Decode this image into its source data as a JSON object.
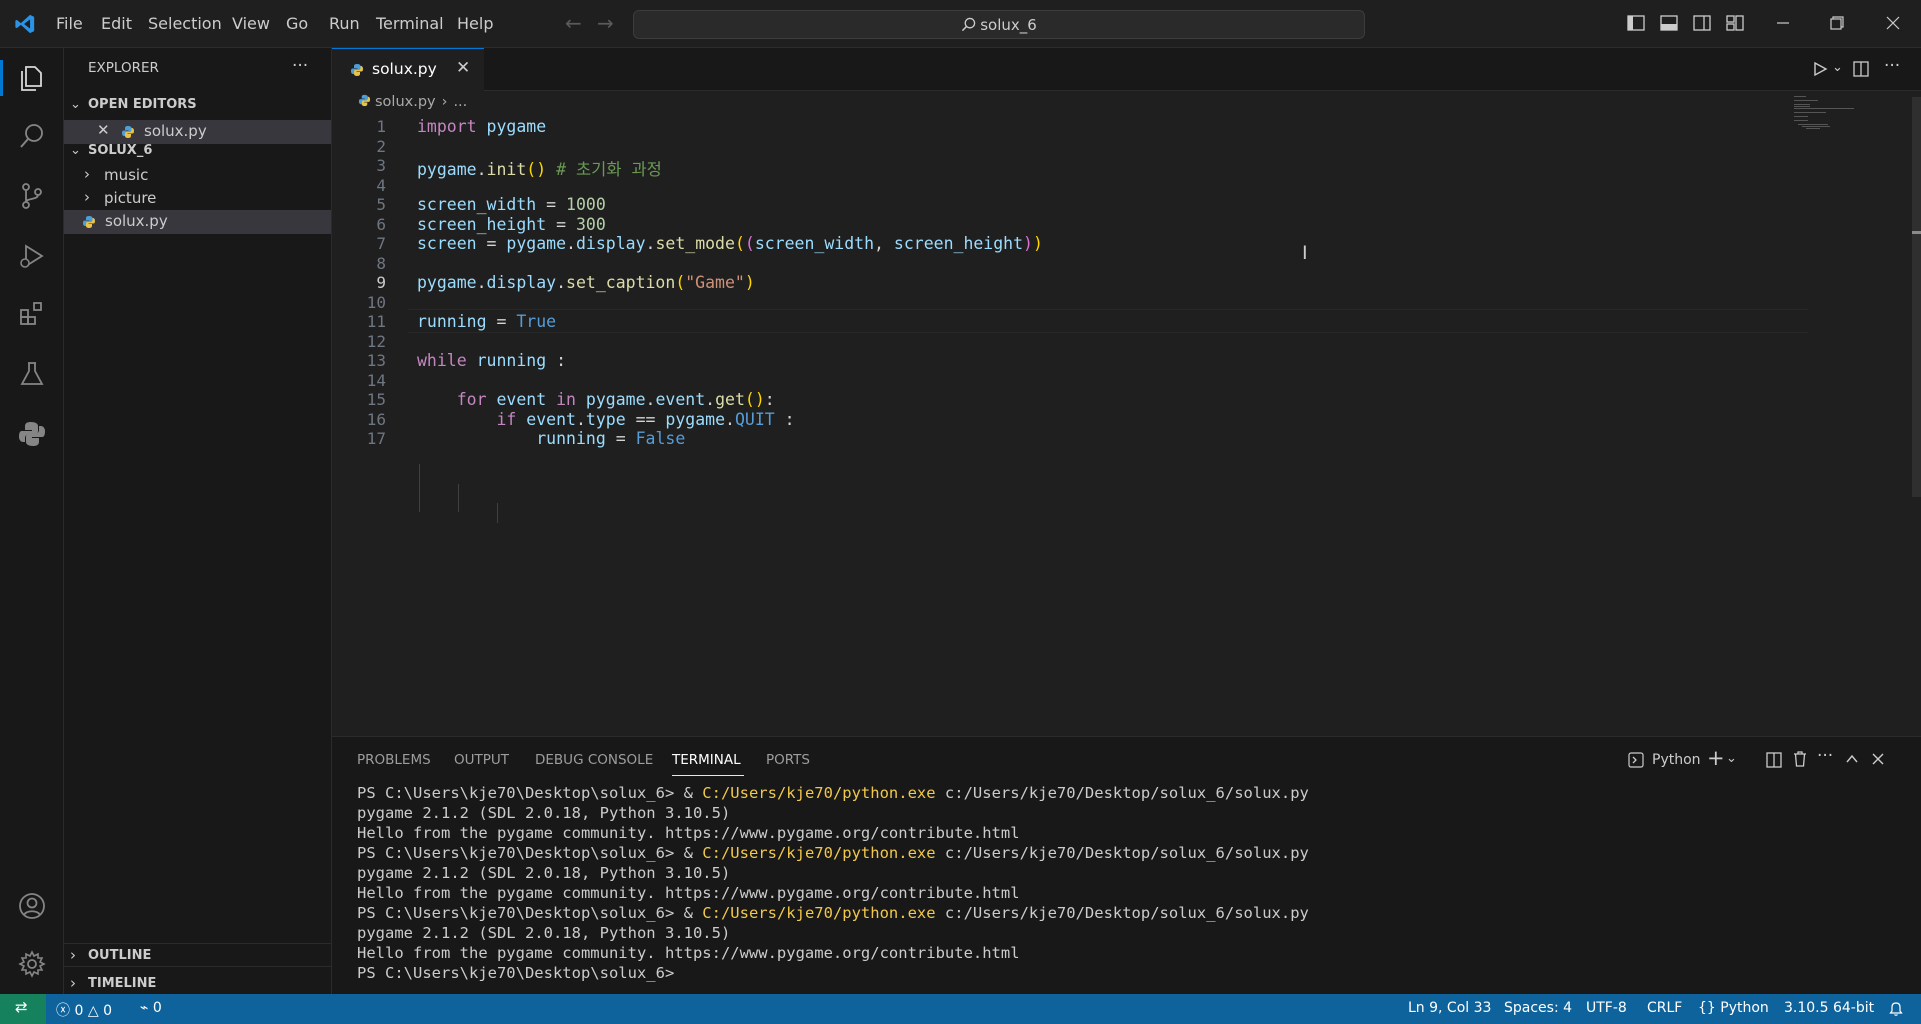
{
  "titlebar": {
    "menu": [
      "File",
      "Edit",
      "Selection",
      "View",
      "Go",
      "Run",
      "Terminal",
      "Help"
    ],
    "search_text": "solux_6"
  },
  "sidebar": {
    "title": "EXPLORER",
    "more": "···",
    "open_editors_label": "OPEN EDITORS",
    "open_editor_file": "solux.py",
    "folder_label": "SOLUX_6",
    "items": [
      "music",
      "picture",
      "solux.py"
    ],
    "outline_label": "OUTLINE",
    "timeline_label": "TIMELINE"
  },
  "editor": {
    "tab_label": "solux.py",
    "breadcrumb_file": "solux.py",
    "breadcrumb_rest": "...",
    "line_numbers": [
      "1",
      "2",
      "3",
      "4",
      "5",
      "6",
      "7",
      "8",
      "9",
      "10",
      "11",
      "12",
      "13",
      "14",
      "15",
      "16",
      "17"
    ],
    "current_line": 9,
    "lines": [
      "import pygame",
      "",
      "pygame.init() # 초기화 과정",
      "",
      "screen_width = 1000",
      "screen_height = 300",
      "screen = pygame.display.set_mode((screen_width, screen_height))",
      "",
      "pygame.display.set_caption(\"Game\")",
      "",
      "running = True",
      "",
      "while running :",
      "",
      "    for event in pygame.event.get():",
      "        if event.type == pygame.QUIT :",
      "            running = False"
    ]
  },
  "panel": {
    "tabs": [
      "PROBLEMS",
      "OUTPUT",
      "DEBUG CONSOLE",
      "TERMINAL",
      "PORTS"
    ],
    "active_tab": "TERMINAL",
    "shell_label": "Python",
    "terminal": {
      "prompt": "PS C:\\Users\\kje70\\Desktop\\solux_6> ",
      "amp": "& ",
      "exe": "C:/Users/kje70/python.exe",
      "script": " c:/Users/kje70/Desktop/solux_6/solux.py",
      "pygame_line": "pygame 2.1.2 (SDL 2.0.18, Python 3.10.5)",
      "hello_line": "Hello from the pygame community. https://www.pygame.org/contribute.html",
      "final_prompt": "PS C:\\Users\\kje70\\Desktop\\solux_6>"
    }
  },
  "statusbar": {
    "errors": "0",
    "warnings": "0",
    "ports": "0",
    "position": "Ln 9, Col 33",
    "spaces": "Spaces: 4",
    "encoding": "UTF-8",
    "eol": "CRLF",
    "language": "Python",
    "interpreter": "3.10.5 64-bit"
  },
  "colors": {
    "accent": "#0078d4",
    "statusbar": "#0e639c"
  }
}
